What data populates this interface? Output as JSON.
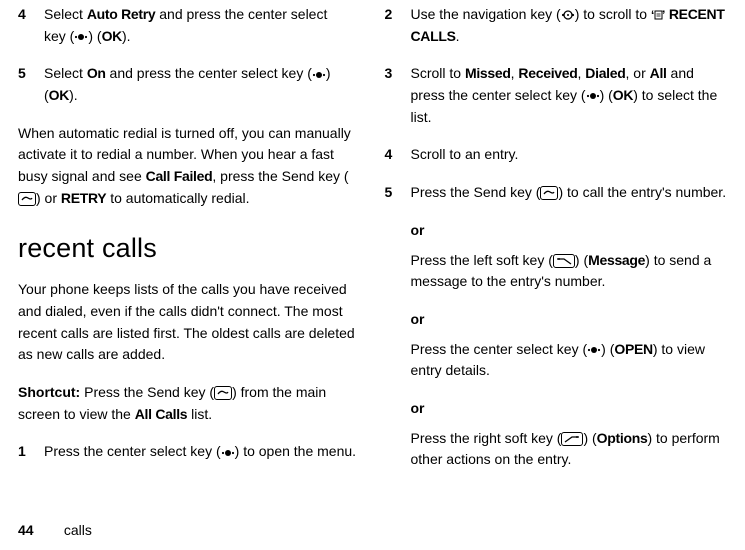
{
  "left": {
    "step4": {
      "num": "4",
      "a": "Select ",
      "autoRetry": "Auto Retry",
      "b": " and press the center select key (",
      "c": ") (",
      "ok": "OK",
      "d": ")."
    },
    "step5": {
      "num": "5",
      "a": "Select ",
      "on": "On",
      "b": " and press the center select key (",
      "c": ") (",
      "ok": "OK",
      "d": ")."
    },
    "para1a": "When automatic redial is turned off, you can manually activate it to redial a number. When you hear a fast busy signal and see ",
    "callFailed": "Call Failed",
    "para1b": ", press the Send key (",
    "para1c": ") or ",
    "retry": "RETRY",
    "para1d": " to automatically redial.",
    "heading": "recent calls",
    "para2": "Your phone keeps lists of the calls you have received and dialed, even if the calls didn't connect. The most recent calls are listed first. The oldest calls are deleted as new calls are added.",
    "shortcutLabel": "Shortcut:",
    "shortcutA": " Press the Send key (",
    "shortcutB": ") from the main screen to view the ",
    "allCalls": "All Calls",
    "shortcutC": " list.",
    "step1": {
      "num": "1",
      "a": "Press the center select key (",
      "b": ") to open the menu."
    }
  },
  "right": {
    "step2": {
      "num": "2",
      "a": "Use the navigation key (",
      "b": ") to scroll to ",
      "menuIconPrefix": "",
      "recentCalls": "RECENT CALLS",
      "c": "."
    },
    "step3": {
      "num": "3",
      "a": "Scroll to ",
      "missed": "Missed",
      "comma1": ", ",
      "received": "Received",
      "comma2": ", ",
      "dialed": "Dialed",
      "comma3": ", or ",
      "all": "All",
      "b": " and press the center select key (",
      "c": ") (",
      "ok": "OK",
      "d": ") to select the list."
    },
    "step4": {
      "num": "4",
      "a": "Scroll to an entry."
    },
    "step5": {
      "num": "5",
      "a": "Press the Send key (",
      "b": ") to call the entry's number.",
      "or1": "or",
      "c": "Press the left soft key (",
      "d": ") (",
      "message": "Message",
      "e": ") to send a message to the entry's number.",
      "or2": "or",
      "f": "Press the center select key (",
      "g": ") (",
      "open": "OPEN",
      "h": ") to view entry details.",
      "or3": "or",
      "i": "Press the right soft key (",
      "j": ") (",
      "options": "Options",
      "k": ") to perform other actions on the entry."
    }
  },
  "footer": {
    "page": "44",
    "section": "calls"
  }
}
